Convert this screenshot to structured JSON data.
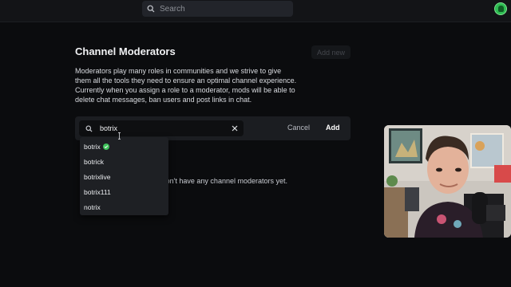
{
  "topbar": {
    "search_placeholder": "Search",
    "icons": {
      "search": "search-icon",
      "profile": "avatar-icon"
    },
    "accent_color": "#2fbd53"
  },
  "header": {
    "title": "Channel Moderators",
    "add_new_label": "Add new"
  },
  "description": {
    "lines": [
      "Moderators play many roles in communities and we strive to give",
      "them all the tools they need to ensure an optimal channel experience.",
      "Currently when you assign a role to a moderator, mods will be able to",
      "delete chat messages, ban users and post links in chat."
    ]
  },
  "add_moderator": {
    "input_value": "botrix",
    "cancel_label": "Cancel",
    "add_label": "Add",
    "icons": {
      "search": "search-icon",
      "clear": "close-icon"
    }
  },
  "suggestions": [
    {
      "name": "botrix",
      "verified": true
    },
    {
      "name": "botrick",
      "verified": false
    },
    {
      "name": "botrixlive",
      "verified": false
    },
    {
      "name": "botrix111",
      "verified": false
    },
    {
      "name": "notrix",
      "verified": false
    }
  ],
  "empty_state": {
    "message": "You don't have any channel moderators yet."
  },
  "colors": {
    "background": "#0b0c0e",
    "panel": "#1b1d21",
    "verified": "#3fc35b"
  }
}
